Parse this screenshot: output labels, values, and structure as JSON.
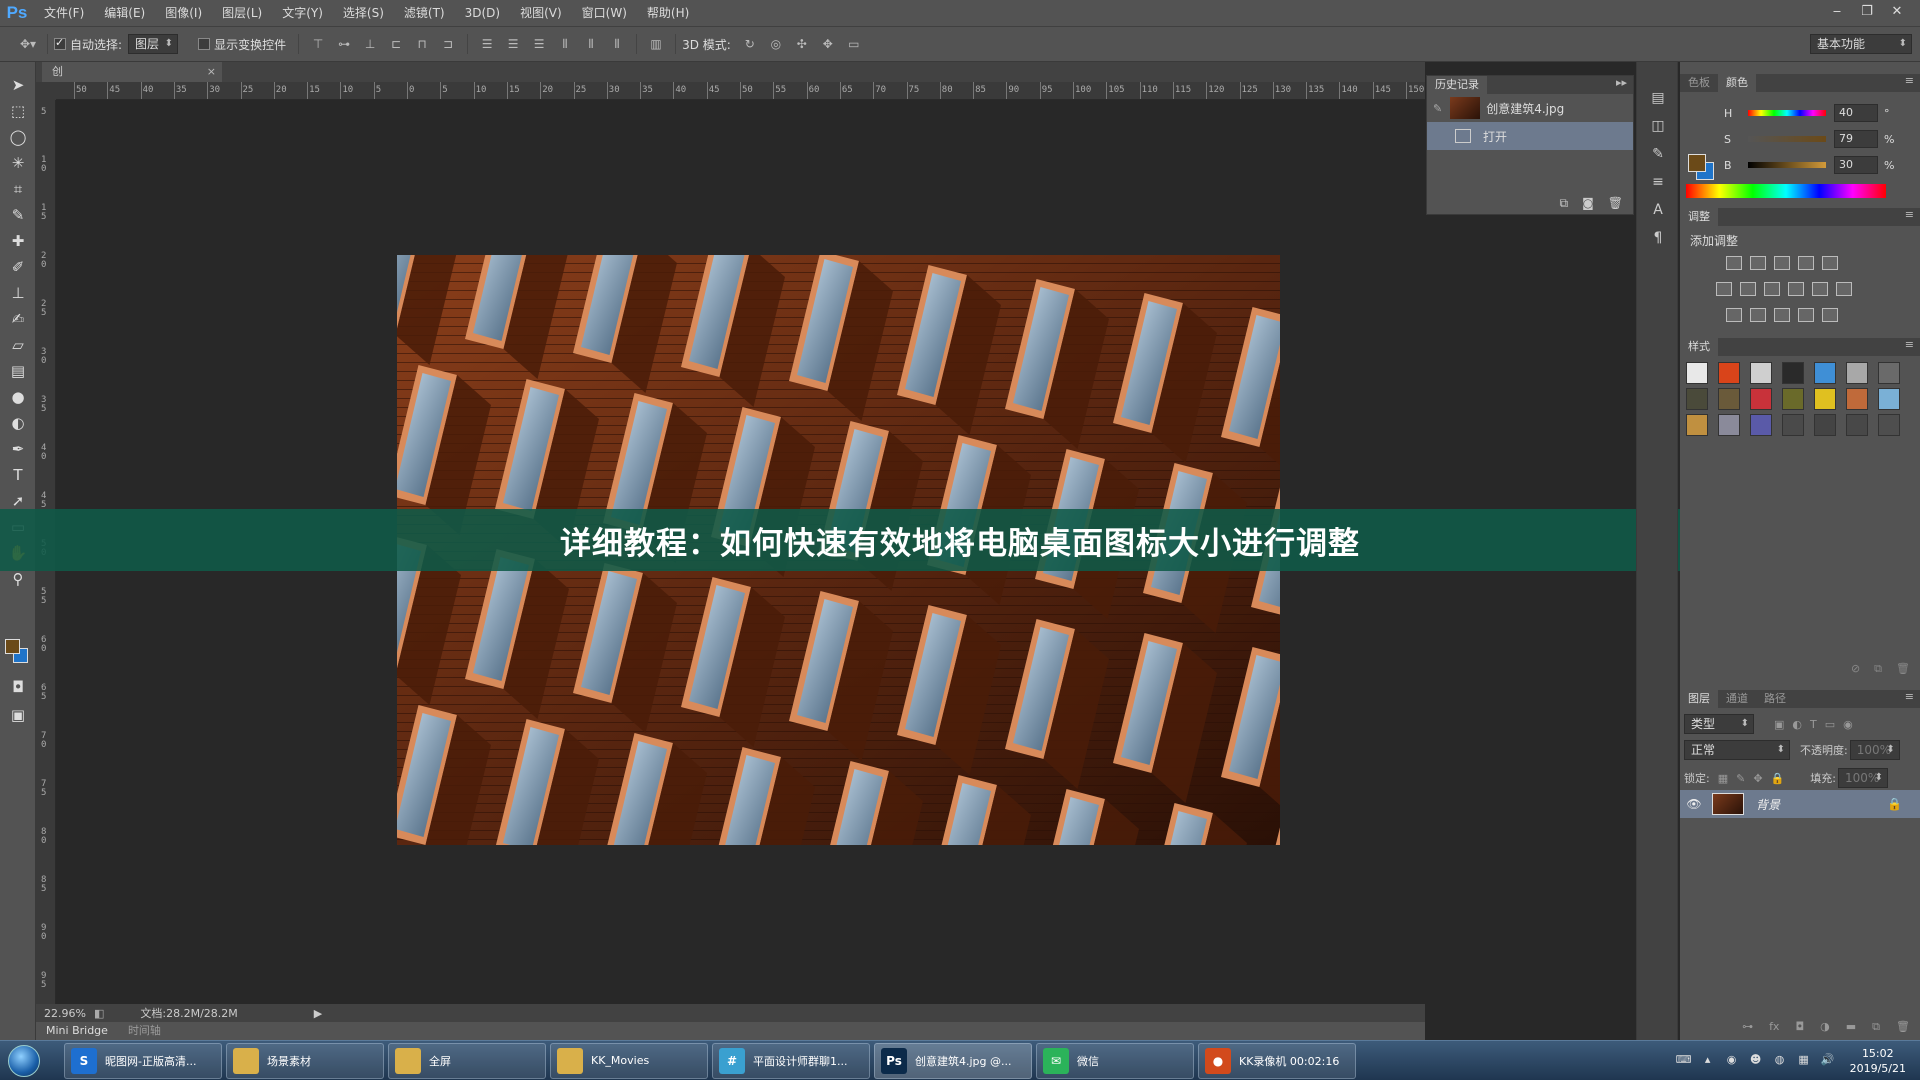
{
  "app": {
    "logo": "Ps",
    "menu": [
      "文件(F)",
      "编辑(E)",
      "图像(I)",
      "图层(L)",
      "文字(Y)",
      "选择(S)",
      "滤镜(T)",
      "3D(D)",
      "视图(V)",
      "窗口(W)",
      "帮助(H)"
    ],
    "window_controls": [
      "‒",
      "❐",
      "✕"
    ]
  },
  "options_bar": {
    "auto_select_label": "自动选择:",
    "auto_select_checked": true,
    "auto_select_value": "图层",
    "show_transform_label": "显示变换控件",
    "mode_3d_label": "3D 模式:",
    "workspace": "基本功能"
  },
  "document": {
    "tab_label": "创",
    "zoom": "22.96%",
    "doc_info": "文档:28.2M/28.2M",
    "ruler_h": [
      "50",
      "45",
      "40",
      "35",
      "30",
      "25",
      "20",
      "15",
      "10",
      "5",
      "0",
      "5",
      "10",
      "15",
      "20",
      "25",
      "30",
      "35",
      "40",
      "45",
      "50",
      "55",
      "60",
      "65",
      "70",
      "75",
      "80",
      "85",
      "90",
      "95",
      "100",
      "105",
      "110",
      "115",
      "120",
      "125",
      "130",
      "135",
      "140",
      "145",
      "150"
    ],
    "ruler_v": [
      "5",
      "1\n0",
      "1\n5",
      "2\n0",
      "2\n5",
      "3\n0",
      "3\n5",
      "4\n0",
      "4\n5",
      "5\n0",
      "5\n5",
      "6\n0",
      "6\n5",
      "7\n0",
      "7\n5",
      "8\n0",
      "8\n5",
      "9\n0",
      "9\n5"
    ]
  },
  "overlay": {
    "title": "详细教程：如何快速有效地将电脑桌面图标大小进行调整"
  },
  "bottom_tabs": [
    "Mini Bridge",
    "时间轴"
  ],
  "history": {
    "tab": "历史记录",
    "items": [
      {
        "label": "创意建筑4.jpg"
      },
      {
        "label": "打开"
      }
    ]
  },
  "color_panel": {
    "tabs": [
      "色板",
      "颜色"
    ],
    "h": {
      "label": "H",
      "value": "40",
      "unit": "°"
    },
    "s": {
      "label": "S",
      "value": "79",
      "unit": "%"
    },
    "b": {
      "label": "B",
      "value": "30",
      "unit": "%"
    },
    "fg": "#6b4a18",
    "bg": "#1f74c9"
  },
  "adjust_panel": {
    "tab": "调整",
    "add_label": "添加调整"
  },
  "styles_panel": {
    "tab": "样式",
    "swatches": [
      "#e8e8e8",
      "#d9441a",
      "#cfcfcf",
      "#2a2a2a",
      "#3f8fd6",
      "#a8a8a8",
      "#6a6a6a",
      "#4a4a3a",
      "#6a5a3a",
      "#c8323a",
      "#6a6a2a",
      "#e0c020",
      "#c06a3a",
      "#7ab0d6",
      "#c09040",
      "#8a8a9a",
      "#5a5aa8",
      "#4a4a4a",
      "#444444",
      "#484848",
      "#4e4e4e"
    ]
  },
  "layers_panel": {
    "tabs": [
      "图层",
      "通道",
      "路径"
    ],
    "filter_label": "类型",
    "blend_mode": "正常",
    "opacity_label": "不透明度:",
    "opacity_value": "100%",
    "lock_label": "锁定:",
    "fill_label": "填充:",
    "fill_value": "100%",
    "layer_name": "背景"
  },
  "taskbar": {
    "items": [
      {
        "label": "昵图网-正版高清...",
        "icon_color": "#1e6fd0",
        "icon_text": "S"
      },
      {
        "label": "场景素材",
        "icon_color": "#d9b04a",
        "icon_text": ""
      },
      {
        "label": "全屏",
        "icon_color": "#d9b04a",
        "icon_text": ""
      },
      {
        "label": "KK_Movies",
        "icon_color": "#d9b04a",
        "icon_text": ""
      },
      {
        "label": "平面设计师群聊1...",
        "icon_color": "#3aa0d0",
        "icon_text": "#"
      },
      {
        "label": "创意建筑4.jpg @...",
        "icon_color": "#0b2a4a",
        "icon_text": "Ps"
      },
      {
        "label": "微信",
        "icon_color": "#2bb35a",
        "icon_text": "✉"
      },
      {
        "label": "KK录像机 00:02:16",
        "icon_color": "#d24a1c",
        "icon_text": "●"
      }
    ],
    "time": "15:02",
    "date": "2019/5/21"
  }
}
